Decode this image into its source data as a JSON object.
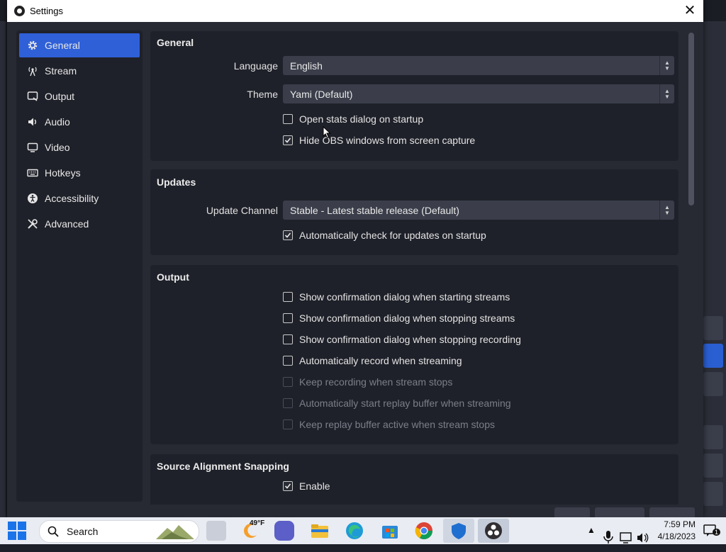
{
  "window": {
    "title": "Settings"
  },
  "sidebar": {
    "items": [
      {
        "label": "General",
        "icon": "gear-icon",
        "active": true
      },
      {
        "label": "Stream",
        "icon": "antenna-icon",
        "active": false
      },
      {
        "label": "Output",
        "icon": "output-icon",
        "active": false
      },
      {
        "label": "Audio",
        "icon": "speaker-icon",
        "active": false
      },
      {
        "label": "Video",
        "icon": "monitor-icon",
        "active": false
      },
      {
        "label": "Hotkeys",
        "icon": "keyboard-icon",
        "active": false
      },
      {
        "label": "Accessibility",
        "icon": "accessibility-icon",
        "active": false
      },
      {
        "label": "Advanced",
        "icon": "tools-icon",
        "active": false
      }
    ]
  },
  "general": {
    "title": "General",
    "language_label": "Language",
    "language_value": "English",
    "theme_label": "Theme",
    "theme_value": "Yami (Default)",
    "open_stats": "Open stats dialog on startup",
    "open_stats_checked": false,
    "hide_obs": "Hide OBS windows from screen capture",
    "hide_obs_checked": true
  },
  "updates": {
    "title": "Updates",
    "channel_label": "Update Channel",
    "channel_value": "Stable - Latest stable release (Default)",
    "auto_check": "Automatically check for updates on startup",
    "auto_check_checked": true
  },
  "output": {
    "title": "Output",
    "options": [
      {
        "label": "Show confirmation dialog when starting streams",
        "checked": false,
        "disabled": false
      },
      {
        "label": "Show confirmation dialog when stopping streams",
        "checked": false,
        "disabled": false
      },
      {
        "label": "Show confirmation dialog when stopping recording",
        "checked": false,
        "disabled": false
      },
      {
        "label": "Automatically record when streaming",
        "checked": false,
        "disabled": false
      },
      {
        "label": "Keep recording when stream stops",
        "checked": false,
        "disabled": true
      },
      {
        "label": "Automatically start replay buffer when streaming",
        "checked": false,
        "disabled": true
      },
      {
        "label": "Keep replay buffer active when stream stops",
        "checked": false,
        "disabled": true
      }
    ]
  },
  "snapping": {
    "title": "Source Alignment Snapping",
    "enable": "Enable",
    "enable_checked": true
  },
  "taskbar": {
    "search_label": "Search",
    "weather_temp": "49°F",
    "time": "7:59 PM",
    "date": "4/18/2023",
    "notifications": "1"
  },
  "colors": {
    "accent": "#2f60d8",
    "panel": "#1f212a",
    "dialog": "#272a33",
    "combo": "#3b3e4a"
  }
}
